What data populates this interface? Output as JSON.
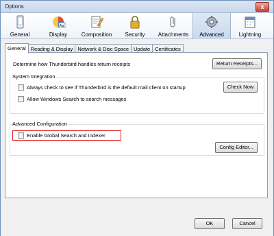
{
  "window": {
    "title": "Options",
    "close_glyph": "x"
  },
  "toolbar": {
    "panes": [
      {
        "label": "General",
        "icon": "phone-icon",
        "selected": false
      },
      {
        "label": "Display",
        "icon": "display-icon",
        "selected": false
      },
      {
        "label": "Composition",
        "icon": "composition-icon",
        "selected": false
      },
      {
        "label": "Security",
        "icon": "lock-icon",
        "selected": false
      },
      {
        "label": "Attachments",
        "icon": "paperclip-icon",
        "selected": false
      },
      {
        "label": "Advanced",
        "icon": "gear-icon",
        "selected": true
      },
      {
        "label": "Lightning",
        "icon": "calendar-icon",
        "selected": false
      }
    ]
  },
  "tabs": [
    {
      "label": "General",
      "active": true
    },
    {
      "label": "Reading & Display",
      "active": false
    },
    {
      "label": "Network & Disc Space",
      "active": false
    },
    {
      "label": "Update",
      "active": false
    },
    {
      "label": "Certificates",
      "active": false
    }
  ],
  "general": {
    "receipts_text": "Determine how Thunderbird handles return receipts",
    "return_receipts_button": "Return Receipts...",
    "system_integration": {
      "title": "System Integration",
      "default_client_checkbox": "Always check to see if Thunderbird is the default mail client on startup",
      "check_now_button": "Check Now",
      "windows_search_checkbox": "Allow Windows Search to search messages"
    },
    "advanced_configuration": {
      "title": "Advanced Configuration",
      "global_search_checkbox": "Enable Global Search and Indexer",
      "config_editor_button": "Config Editor..."
    }
  },
  "footer": {
    "ok_label": "OK",
    "cancel_label": "Cancel"
  },
  "colors": {
    "highlight": "#e02020",
    "selected_pane": "#c7d8ee"
  }
}
